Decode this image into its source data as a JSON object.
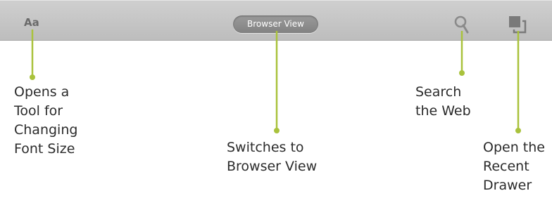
{
  "toolbar": {
    "font_button_label": "Aa",
    "browser_view_label": "Browser View",
    "search_icon": "search-icon",
    "drawer_icon": "recent-drawer-icon",
    "background_color": "#c6c6c6"
  },
  "callouts": {
    "leader_color": "#a9c23c",
    "font_size": [
      "Opens a",
      "Tool for",
      "Changing",
      "Font Size"
    ],
    "browser_view": [
      "Switches to",
      "Browser View"
    ],
    "search": [
      "Search",
      "the Web"
    ],
    "recent_drawer": [
      "Open the",
      "Recent",
      "Drawer"
    ]
  }
}
